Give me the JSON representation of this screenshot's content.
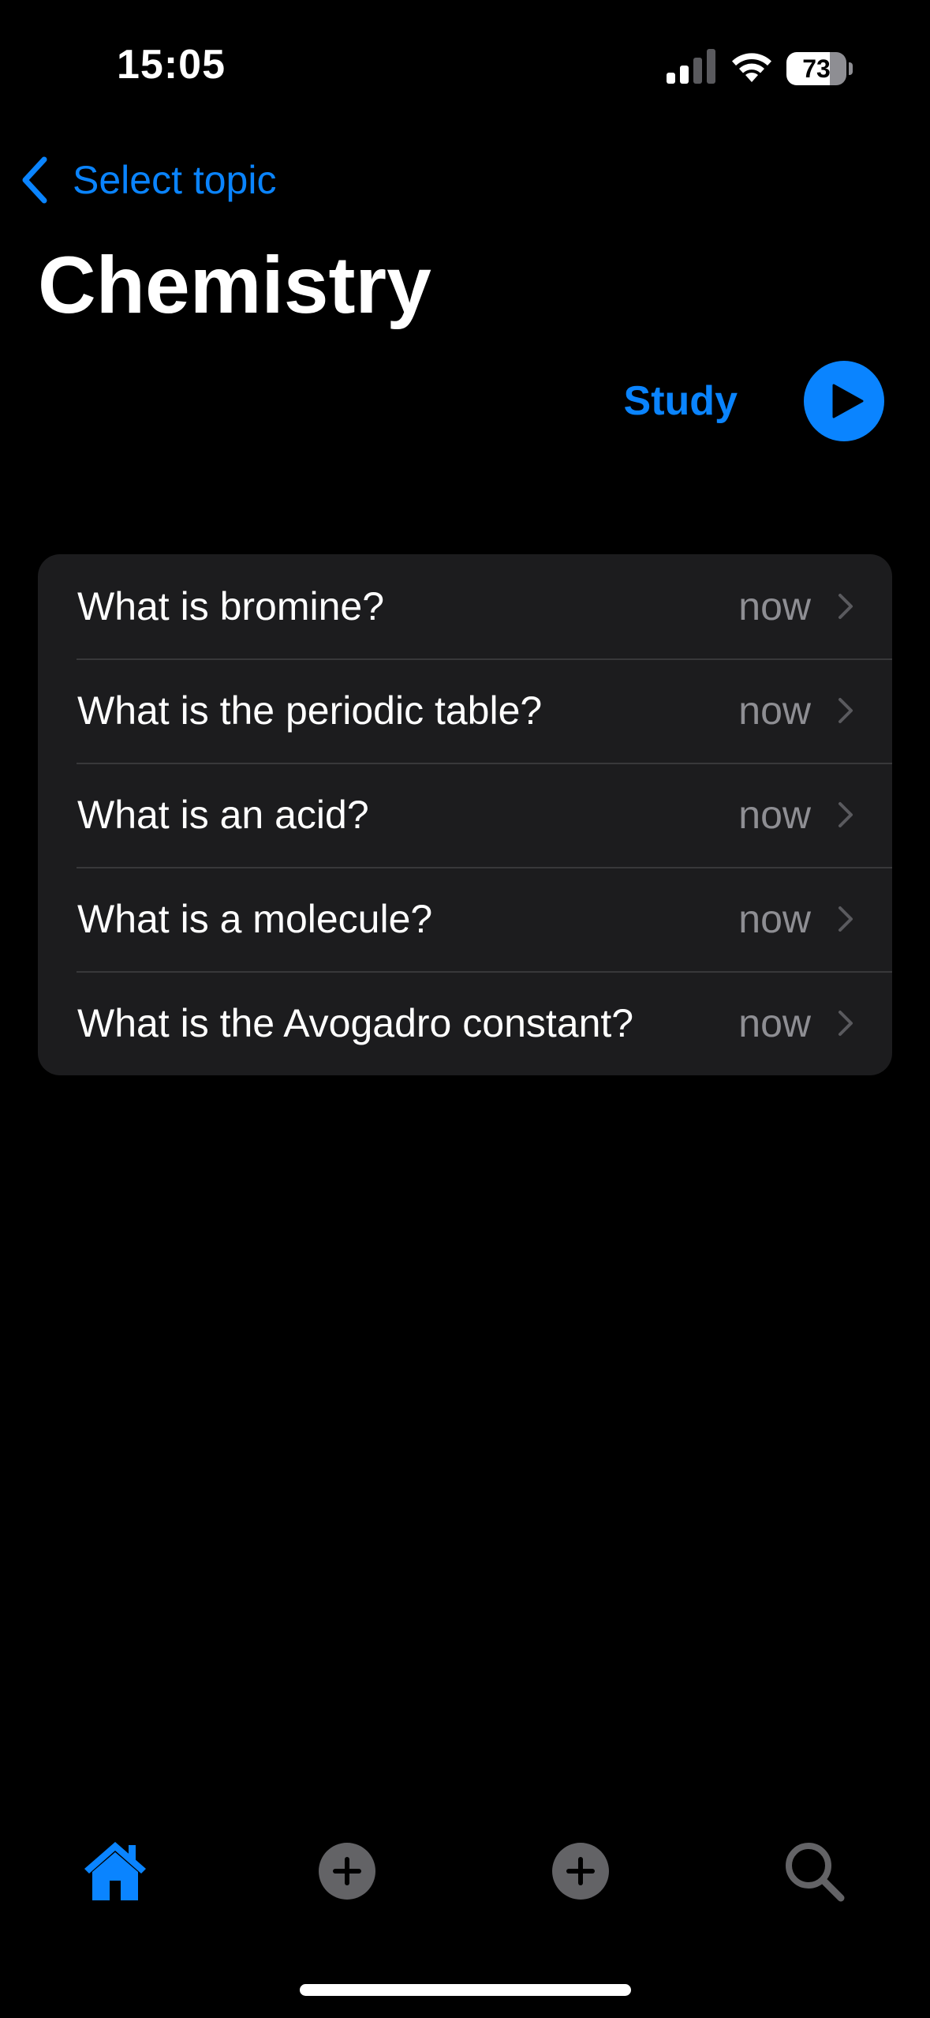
{
  "status_bar": {
    "time": "15:05",
    "battery_level": "73",
    "battery_fraction": 0.73,
    "icons": [
      "cellular-signal-icon",
      "wifi-icon",
      "battery-icon"
    ]
  },
  "nav": {
    "back_label": "Select topic",
    "back_icon": "chevron-left-icon"
  },
  "page": {
    "title": "Chemistry"
  },
  "study": {
    "label": "Study",
    "icon": "play-icon"
  },
  "questions": [
    {
      "text": "What is bromine?",
      "when": "now"
    },
    {
      "text": "What is the periodic table?",
      "when": "now"
    },
    {
      "text": "What is an acid?",
      "when": "now"
    },
    {
      "text": "What is a molecule?",
      "when": "now"
    },
    {
      "text": "What is the Avogadro constant?",
      "when": "now"
    }
  ],
  "tab_bar": {
    "tabs": [
      {
        "icon": "home-icon",
        "active": true
      },
      {
        "icon": "plus-circle-icon",
        "active": false
      },
      {
        "icon": "plus-circle-icon",
        "active": false
      },
      {
        "icon": "search-icon",
        "active": false
      }
    ]
  },
  "colors": {
    "background": "#000000",
    "accent": "#0a84ff",
    "card": "#1c1c1e",
    "secondary_text": "#8e8e93",
    "separator": "#38383a",
    "inactive_icon": "#636366"
  }
}
